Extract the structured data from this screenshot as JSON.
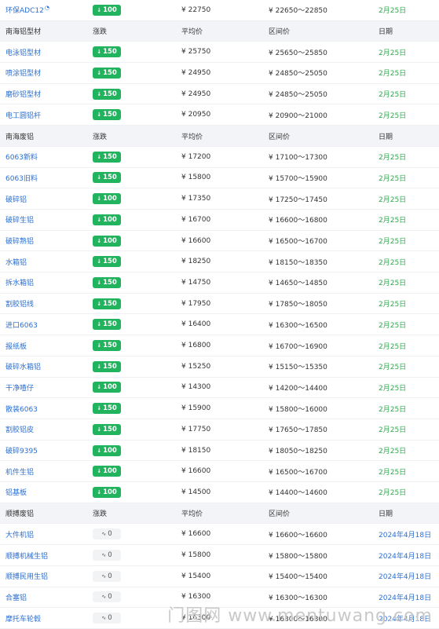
{
  "rows": [
    {
      "kind": "data",
      "name": "环保ADC12",
      "trend": "up",
      "change": "100",
      "avg": "22750",
      "range": "22650～22850",
      "date": "2月25日"
    },
    {
      "kind": "header",
      "name": "南海铝型材",
      "change": "涨跌",
      "avg": "平均价",
      "range": "区间价",
      "date": "日期"
    },
    {
      "kind": "data",
      "name": "电泳铝型材",
      "trend": "up",
      "change": "150",
      "avg": "25750",
      "range": "25650～25850",
      "date": "2月25日"
    },
    {
      "kind": "data",
      "name": "喷涂铝型材",
      "trend": "up",
      "change": "150",
      "avg": "24950",
      "range": "24850～25050",
      "date": "2月25日"
    },
    {
      "kind": "data",
      "name": "磨砂铝型材",
      "trend": "up",
      "change": "150",
      "avg": "24950",
      "range": "24850～25050",
      "date": "2月25日"
    },
    {
      "kind": "data",
      "name": "电工圆铝杆",
      "trend": "up",
      "change": "150",
      "avg": "20950",
      "range": "20900～21000",
      "date": "2月25日"
    },
    {
      "kind": "header",
      "name": "南海废铝",
      "change": "涨跌",
      "avg": "平均价",
      "range": "区间价",
      "date": "日期"
    },
    {
      "kind": "data",
      "name": "6063新料",
      "trend": "up",
      "change": "150",
      "avg": "17200",
      "range": "17100～17300",
      "date": "2月25日"
    },
    {
      "kind": "data",
      "name": "6063旧料",
      "trend": "up",
      "change": "150",
      "avg": "15800",
      "range": "15700～15900",
      "date": "2月25日"
    },
    {
      "kind": "data",
      "name": "破碎铝",
      "trend": "up",
      "change": "100",
      "avg": "17350",
      "range": "17250～17450",
      "date": "2月25日"
    },
    {
      "kind": "data",
      "name": "破碎生铝",
      "trend": "up",
      "change": "100",
      "avg": "16700",
      "range": "16600～16800",
      "date": "2月25日"
    },
    {
      "kind": "data",
      "name": "破碎熟铝",
      "trend": "up",
      "change": "100",
      "avg": "16600",
      "range": "16500～16700",
      "date": "2月25日"
    },
    {
      "kind": "data",
      "name": "水箱铝",
      "trend": "up",
      "change": "150",
      "avg": "18250",
      "range": "18150～18350",
      "date": "2月25日"
    },
    {
      "kind": "data",
      "name": "拆水箱铝",
      "trend": "up",
      "change": "150",
      "avg": "14750",
      "range": "14650～14850",
      "date": "2月25日"
    },
    {
      "kind": "data",
      "name": "割胶铝线",
      "trend": "up",
      "change": "150",
      "avg": "17950",
      "range": "17850～18050",
      "date": "2月25日"
    },
    {
      "kind": "data",
      "name": "进口6063",
      "trend": "up",
      "change": "150",
      "avg": "16400",
      "range": "16300～16500",
      "date": "2月25日"
    },
    {
      "kind": "data",
      "name": "报纸板",
      "trend": "up",
      "change": "150",
      "avg": "16800",
      "range": "16700～16900",
      "date": "2月25日"
    },
    {
      "kind": "data",
      "name": "破碎水箱铝",
      "trend": "up",
      "change": "150",
      "avg": "15250",
      "range": "15150～15350",
      "date": "2月25日"
    },
    {
      "kind": "data",
      "name": "干净喳仔",
      "trend": "up",
      "change": "100",
      "avg": "14300",
      "range": "14200～14400",
      "date": "2月25日"
    },
    {
      "kind": "data",
      "name": "散装6063",
      "trend": "up",
      "change": "150",
      "avg": "15900",
      "range": "15800～16000",
      "date": "2月25日"
    },
    {
      "kind": "data",
      "name": "割胶铝皮",
      "trend": "up",
      "change": "150",
      "avg": "17750",
      "range": "17650～17850",
      "date": "2月25日"
    },
    {
      "kind": "data",
      "name": "破碎9395",
      "trend": "up",
      "change": "100",
      "avg": "18150",
      "range": "18050～18250",
      "date": "2月25日"
    },
    {
      "kind": "data",
      "name": "机件生铝",
      "trend": "up",
      "change": "100",
      "avg": "16600",
      "range": "16500～16700",
      "date": "2月25日"
    },
    {
      "kind": "data",
      "name": "铝基板",
      "trend": "up",
      "change": "100",
      "avg": "14500",
      "range": "14400～14600",
      "date": "2月25日"
    },
    {
      "kind": "header",
      "name": "顺搏废铝",
      "change": "涨跌",
      "avg": "平均价",
      "range": "区间价",
      "date": "日期"
    },
    {
      "kind": "data",
      "name": "大件机铝",
      "trend": "flat",
      "change": "0",
      "avg": "16600",
      "range": "16600～16600",
      "date": "2024年4月18日"
    },
    {
      "kind": "data",
      "name": "顺搏机械生铝",
      "trend": "flat",
      "change": "0",
      "avg": "15800",
      "range": "15800～15800",
      "date": "2024年4月18日"
    },
    {
      "kind": "data",
      "name": "顺搏民用生铝",
      "trend": "flat",
      "change": "0",
      "avg": "15400",
      "range": "15400～15400",
      "date": "2024年4月18日"
    },
    {
      "kind": "data",
      "name": "合塞铝",
      "trend": "flat",
      "change": "0",
      "avg": "16300",
      "range": "16300～16300",
      "date": "2024年4月18日"
    },
    {
      "kind": "data",
      "name": "摩托车轮毂",
      "trend": "flat",
      "change": "0",
      "avg": "16300",
      "range": "16300～16300",
      "date": "2024年4月18日"
    }
  ],
  "currency_symbol": "¥",
  "watermark": "门图网 www.mentuwang.com"
}
